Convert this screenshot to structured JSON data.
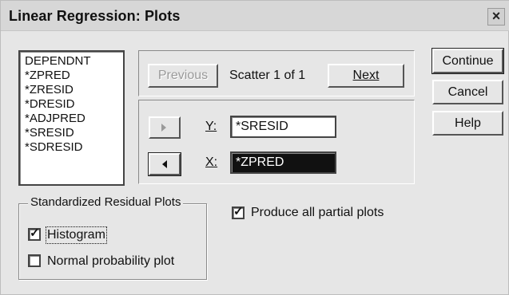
{
  "window": {
    "title": "Linear Regression: Plots",
    "close_glyph": "×"
  },
  "variables": {
    "items": [
      "DEPENDNT",
      "*ZPRED",
      "*ZRESID",
      "*DRESID",
      "*ADJPRED",
      "*SRESID",
      "*SDRESID"
    ]
  },
  "scatter": {
    "previous_label": "Previous",
    "status": "Scatter 1 of 1",
    "next_label": "Next",
    "y_label": "Y:",
    "y_value": "*SRESID",
    "x_label": "X:",
    "x_value": "*ZPRED"
  },
  "buttons": {
    "continue": "Continue",
    "cancel": "Cancel",
    "help": "Help"
  },
  "residual_plots": {
    "legend": "Standardized Residual Plots",
    "histogram_label": "Histogram",
    "histogram_checked": true,
    "normal_prob_label": "Normal probability plot",
    "normal_prob_checked": false
  },
  "partial": {
    "label": "Produce all partial plots",
    "checked": true
  },
  "icons": {
    "move_right": "arrow-right-icon",
    "move_left": "arrow-left-icon",
    "close": "close-icon",
    "checkmark": "check-icon"
  },
  "colors": {
    "dialog_bg": "#e6e6e6",
    "selection": "#111111",
    "disabled_text": "#9a9a9a"
  }
}
